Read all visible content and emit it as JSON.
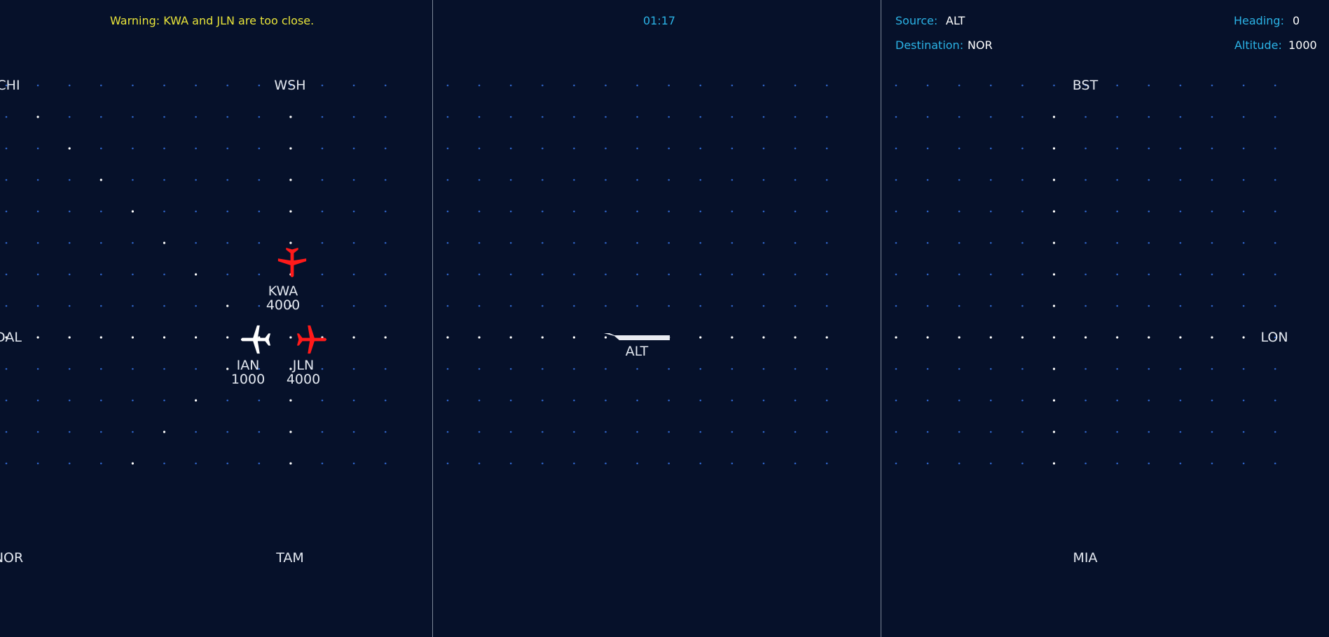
{
  "left_panel": {
    "warning": "Warning: KWA and JLN are too close."
  },
  "center_panel": {
    "timer": "01:17",
    "runway_label": "ALT"
  },
  "right_panel": {
    "source_label": "Source:",
    "source_value": "ALT",
    "destination_label": "Destination:",
    "destination_value": "NOR",
    "heading_label": "Heading:",
    "heading_value": "0",
    "altitude_label": "Altitude:",
    "altitude_value": "1000"
  },
  "airports": {
    "chi": "CHI",
    "wsh": "WSH",
    "dal": "DAL",
    "nor": "NOR",
    "tam": "TAM",
    "bst": "BST",
    "lon": "LON",
    "mia": "MIA"
  },
  "planes": {
    "kwa": {
      "callsign": "KWA",
      "altitude": "4000",
      "status": "conflict",
      "color": "#ff1a1a",
      "icon": "airplane-icon"
    },
    "ian": {
      "callsign": "IAN",
      "altitude": "1000",
      "status": "selected",
      "color": "#ffffff",
      "icon": "airplane-icon"
    },
    "jln": {
      "callsign": "JLN",
      "altitude": "4000",
      "status": "conflict",
      "color": "#ff1a1a",
      "icon": "airplane-icon"
    }
  },
  "colors": {
    "background": "#06112a",
    "grid_dot": "#2f63c4",
    "route_dot": "#ffffff",
    "warning": "#e8e43a",
    "accent": "#2bb3e6"
  }
}
